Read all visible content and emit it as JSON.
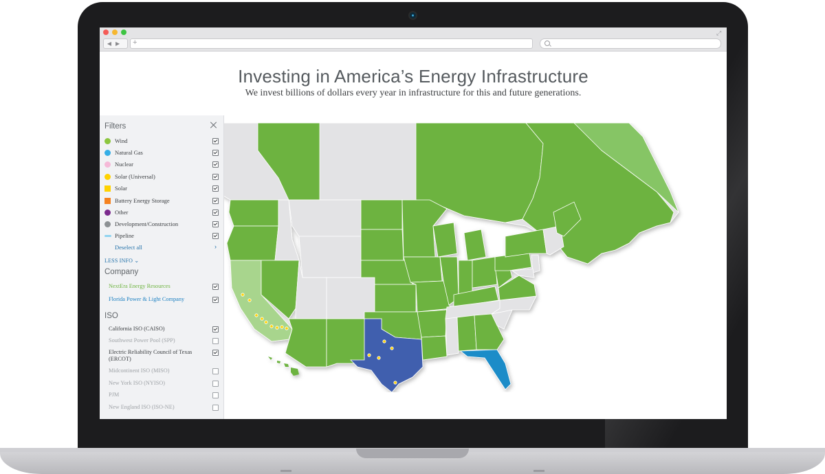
{
  "page": {
    "title": "Investing in America’s Energy Infrastructure",
    "subtitle": "We invest billions of dollars every year in infrastructure for this and future generations."
  },
  "colors": {
    "accent_green": "#6db33f",
    "light_green": "#a8d58d",
    "texas_blue": "#3f5fae",
    "florida_blue": "#1a8cc8",
    "inactive_gray": "#e3e3e5",
    "link_blue": "#1f6fa8"
  },
  "sidebar": {
    "filters_heading": "Filters",
    "filters": [
      {
        "label": "Wind",
        "color": "#8cc63f",
        "shape": "circle",
        "checked": true
      },
      {
        "label": "Natural Gas",
        "color": "#35aee6",
        "shape": "circle",
        "checked": true
      },
      {
        "label": "Nuclear",
        "color": "#f5b9d8",
        "shape": "circle",
        "checked": true
      },
      {
        "label": "Solar (Universal)",
        "color": "#ffd200",
        "shape": "circle",
        "checked": true
      },
      {
        "label": "Solar",
        "color": "#ffd200",
        "shape": "square",
        "checked": true
      },
      {
        "label": "Battery Energy Storage",
        "color": "#f58220",
        "shape": "square",
        "checked": true
      },
      {
        "label": "Other",
        "color": "#7b2a8d",
        "shape": "circle",
        "checked": true
      },
      {
        "label": "Development/Construction",
        "color": "#8d9194",
        "shape": "circle",
        "checked": true
      },
      {
        "label": "Pipeline",
        "color": "#8fd3f0",
        "shape": "line",
        "checked": true
      }
    ],
    "deselect_label": "Deselect all",
    "less_info_label": "LESS INFO ⌄",
    "company_heading": "Company",
    "companies": [
      {
        "label": "NextEra Energy Resources",
        "color": "#6db33f",
        "checked": true
      },
      {
        "label": "Florida Power & Light Company",
        "color": "#1a7fc1",
        "checked": true
      }
    ],
    "iso_heading": "ISO",
    "isos": [
      {
        "label": "California ISO (CAISO)",
        "checked": true
      },
      {
        "label": "Southwest Power Pool (SPP)",
        "checked": false
      },
      {
        "label": "Electric Reliability Council of Texas (ERCOT)",
        "checked": true
      },
      {
        "label": "Midcontinent ISO (MISO)",
        "checked": false
      },
      {
        "label": "New York ISO (NYISO)",
        "checked": false
      },
      {
        "label": "PJM",
        "checked": false
      },
      {
        "label": "New England ISO (ISO-NE)",
        "checked": false
      }
    ]
  }
}
